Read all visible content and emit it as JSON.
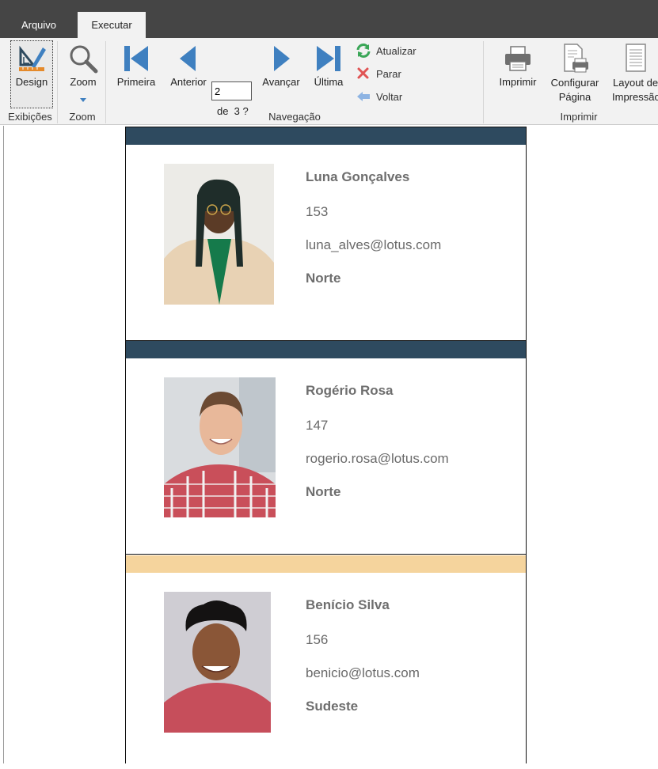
{
  "tabs": [
    {
      "label": "Arquivo",
      "active": false
    },
    {
      "label": "Executar",
      "active": true
    }
  ],
  "ribbon": {
    "views": {
      "design_label": "Design",
      "group_label": "Exibições"
    },
    "zoom": {
      "label": "Zoom",
      "group_label": "Zoom"
    },
    "navigation": {
      "first_label": "Primeira",
      "previous_label": "Anterior",
      "page_value": "2",
      "page_of": "de  3 ?",
      "next_label": "Avançar",
      "last_label": "Última",
      "refresh_label": "Atualizar",
      "stop_label": "Parar",
      "back_label": "Voltar",
      "group_label": "Navegação"
    },
    "print": {
      "print_label": "Imprimir",
      "page_setup_label_1": "Configurar",
      "page_setup_label_2": "Página",
      "layout_label_1": "Layout de",
      "layout_label_2": "Impressão",
      "group_label": "Imprimir"
    }
  },
  "colors": {
    "accent_dark": "#2e4a5f",
    "accent_gold": "#f5d49d",
    "nav_blue": "#3f80c0"
  },
  "report": {
    "records": [
      {
        "name": "Luna Gonçalves",
        "number": "153",
        "email": "luna_alves@lotus.com",
        "region": "Norte",
        "bar_color": "#2e4a5f"
      },
      {
        "name": "Rogério Rosa",
        "number": "147",
        "email": "rogerio.rosa@lotus.com",
        "region": "Norte",
        "bar_color": "#2e4a5f"
      },
      {
        "name": "Benício Silva",
        "number": "156",
        "email": "benicio@lotus.com",
        "region": "Sudeste",
        "bar_color": "#f5d49d"
      }
    ]
  }
}
